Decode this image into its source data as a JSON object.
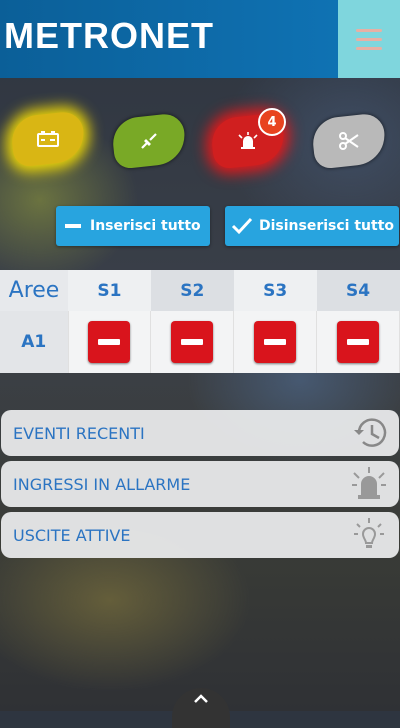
{
  "header": {
    "logo_text": "METRONET",
    "menu_icon": "hamburger-icon"
  },
  "status_icons": [
    {
      "name": "battery-icon",
      "color": "#d9b614"
    },
    {
      "name": "plug-icon",
      "color": "#79a926"
    },
    {
      "name": "alarm-bell-icon",
      "color": "#d01f1f",
      "badge": "4"
    },
    {
      "name": "scissors-icon",
      "color": "#b9b9b9"
    }
  ],
  "actions": {
    "arm_all": "Inserisci tutto",
    "disarm_all": "Disinserisci tutto"
  },
  "areas_table": {
    "corner_label": "Aree",
    "columns": [
      "S1",
      "S2",
      "S3",
      "S4"
    ],
    "rows": [
      {
        "label": "A1",
        "states": [
          "minus",
          "minus",
          "minus",
          "minus"
        ]
      }
    ]
  },
  "menu_items": [
    {
      "label": "EVENTI RECENTI",
      "icon": "history-clock-icon"
    },
    {
      "label": "INGRESSI IN ALLARME",
      "icon": "alarm-bell-icon"
    },
    {
      "label": "USCITE ATTIVE",
      "icon": "lightbulb-icon"
    }
  ],
  "colors": {
    "accent": "#28a4df",
    "header": "#0f72b3",
    "text_blue": "#2b74c2",
    "danger": "#d9141c"
  }
}
